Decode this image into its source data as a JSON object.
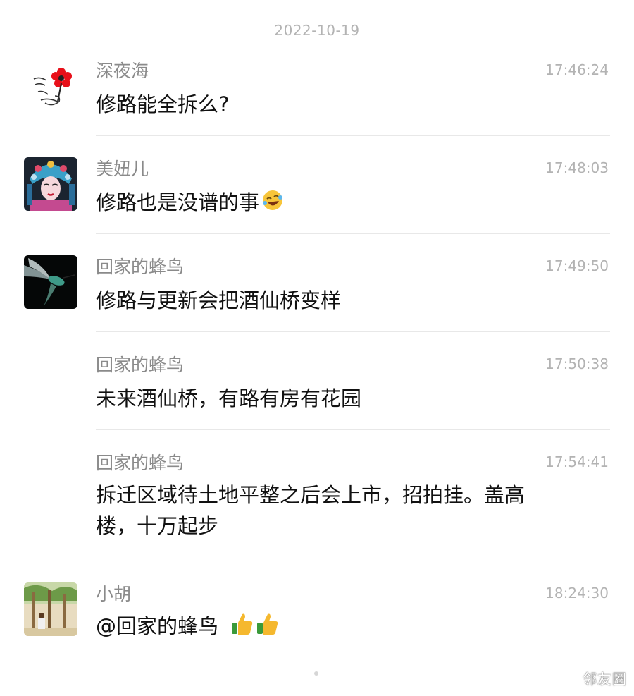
{
  "date_separator": "2022-10-19",
  "comments": [
    {
      "name": "深夜海",
      "time": "17:46:24",
      "text": "修路能全拆么?",
      "avatar_icon": "flower-sketch-avatar"
    },
    {
      "name": "美妞儿",
      "time": "17:48:03",
      "text": "修路也是没谱的事",
      "emoji": "laughing-crying-emoji",
      "avatar_icon": "opera-mask-avatar"
    },
    {
      "name": "回家的蜂鸟",
      "time": "17:49:50",
      "text": "修路与更新会把酒仙桥变样",
      "avatar_icon": "hummingbird-avatar"
    },
    {
      "name": "回家的蜂鸟",
      "time": "17:50:38",
      "text": "未来酒仙桥，有路有房有花园"
    },
    {
      "name": "回家的蜂鸟",
      "time": "17:54:41",
      "text_line1": "拆迁区域待土地平整之后会上市，招拍挂。盖高",
      "text_line2": "楼，十万起步"
    },
    {
      "name": "小胡",
      "time": "18:24:30",
      "text": "@回家的蜂鸟",
      "emoji": "thumbs-up-emoji ×2",
      "avatar_icon": "palm-trees-avatar"
    }
  ],
  "watermark": "邻友圈",
  "colors": {
    "name": "#8a8a8a",
    "time": "#b3b3b3",
    "text": "#111111",
    "divider": "#e8e8e8"
  }
}
